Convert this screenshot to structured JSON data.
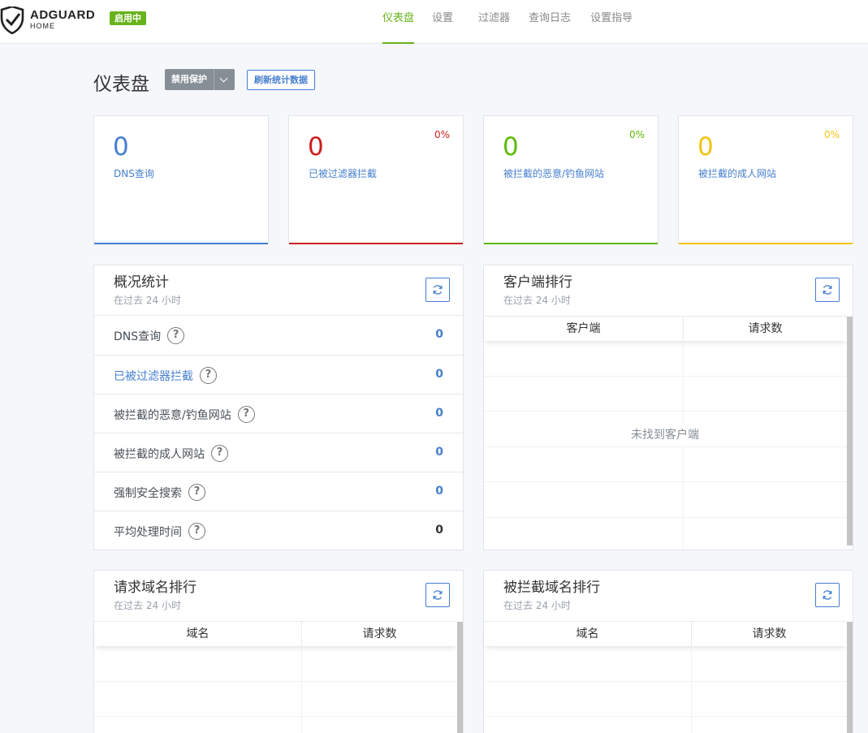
{
  "header": {
    "brand_name": "ADGUARD",
    "brand_sub": "HOME",
    "status_badge": "启用中",
    "nav": [
      {
        "label": "仪表盘",
        "active": true
      },
      {
        "label": "设置",
        "active": false
      },
      {
        "label": "过滤器",
        "active": false
      },
      {
        "label": "查询日志",
        "active": false
      },
      {
        "label": "设置指导",
        "active": false
      }
    ]
  },
  "page": {
    "title": "仪表盘",
    "disable_button": "禁用保护",
    "refresh_button": "刷新统计数据"
  },
  "stat_cards": [
    {
      "value": "0",
      "label": "DNS查询",
      "percent": "",
      "color": "#467fcf"
    },
    {
      "value": "0",
      "label": "已被过滤器拦截",
      "percent": "0%",
      "color": "#cd201f"
    },
    {
      "value": "0",
      "label": "被拦截的恶意/钓鱼网站",
      "percent": "0%",
      "color": "#5eba00"
    },
    {
      "value": "0",
      "label": "被拦截的成人网站",
      "percent": "0%",
      "color": "#f1c40f"
    }
  ],
  "overview": {
    "title": "概况统计",
    "subtitle": "在过去 24 小时",
    "rows": [
      {
        "label": "DNS查询",
        "value": "0"
      },
      {
        "label": "已被过滤器拦截",
        "value": "0"
      },
      {
        "label": "被拦截的恶意/钓鱼网站",
        "value": "0"
      },
      {
        "label": "被拦截的成人网站",
        "value": "0"
      },
      {
        "label": "强制安全搜索",
        "value": "0"
      },
      {
        "label": "平均处理时间",
        "value": "0"
      }
    ]
  },
  "clients": {
    "title": "客户端排行",
    "subtitle": "在过去 24 小时",
    "col1": "客户端",
    "col2": "请求数",
    "empty": "未找到客户端"
  },
  "domains": {
    "title": "请求域名排行",
    "subtitle": "在过去 24 小时",
    "col1": "域名",
    "col2": "请求数"
  },
  "blocked": {
    "title": "被拦截域名排行",
    "subtitle": "在过去 24 小时",
    "col1": "域名",
    "col2": "请求数"
  },
  "icons": {
    "logo": "shield-check-icon",
    "refresh": "refresh-icon",
    "help": "question-circle-icon",
    "caret": "chevron-down-icon"
  }
}
